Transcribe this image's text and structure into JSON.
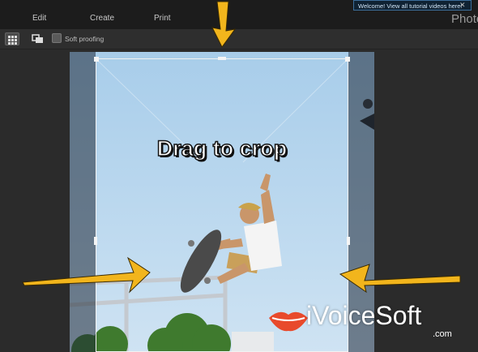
{
  "menu": {
    "edit": "Edit",
    "create": "Create",
    "print": "Print"
  },
  "notice": {
    "text": "Welcome! View all tutorial videos here!",
    "close": "✕"
  },
  "brand": "Photo",
  "toolbar": {
    "soft_proofing_label": "Soft proofing"
  },
  "canvas": {
    "instruction": "Drag to crop"
  },
  "watermark": {
    "name": "iVoiceSoft",
    "suffix": ".com"
  },
  "colors": {
    "arrow": "#f2b51c",
    "lips": "#e84a2c"
  },
  "icons": [
    "grid-view-icon",
    "compare-view-icon",
    "checkbox-icon",
    "close-icon",
    "arrow-icon",
    "lips-logo-icon"
  ]
}
